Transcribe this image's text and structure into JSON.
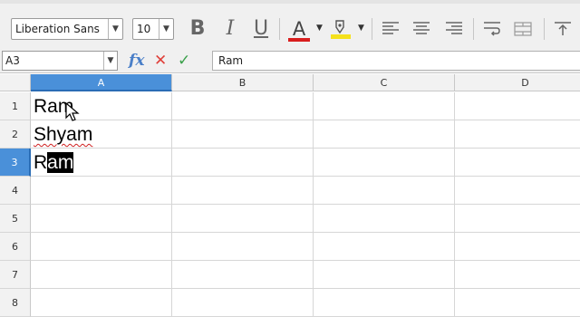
{
  "toolbar": {
    "font_name": "Liberation Sans",
    "font_size": "10",
    "bold_label": "B",
    "italic_label": "I",
    "underline_label": "U",
    "font_color_label": "A",
    "font_color_accent": "#d81e1e",
    "highlight_accent": "#f5e11c"
  },
  "formula_bar": {
    "name_box": "A3",
    "fx_label": "fx",
    "cancel_label": "✕",
    "accept_label": "✓",
    "content": "Ram"
  },
  "sheet": {
    "columns": [
      "A",
      "B",
      "C",
      "D"
    ],
    "active_column": "A",
    "rows": [
      "1",
      "2",
      "3",
      "4",
      "5",
      "6",
      "7",
      "8"
    ],
    "active_row": "3",
    "cells": {
      "A1": "Ram",
      "A2": "Shyam",
      "A3_prefix": "R",
      "A3_selected": "am"
    }
  },
  "colors": {
    "header_active": "#4a90d9",
    "squiggle": "#d02020"
  }
}
